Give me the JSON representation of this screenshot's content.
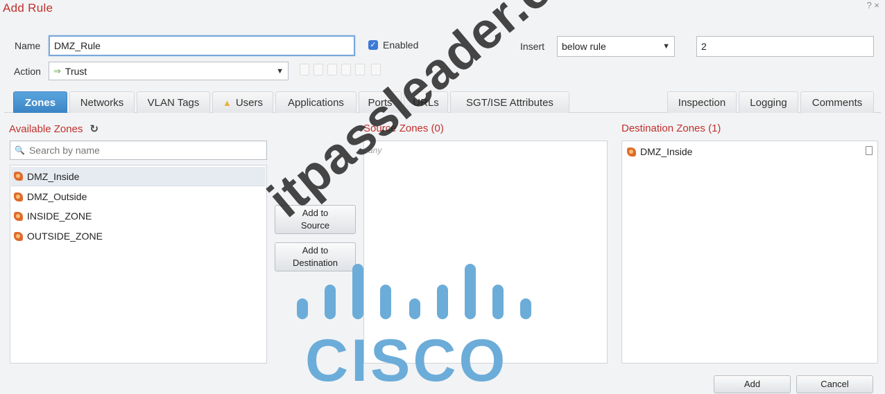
{
  "window": {
    "title": "Add Rule",
    "controls": "? ×"
  },
  "form": {
    "name_label": "Name",
    "name_value": "DMZ_Rule",
    "enabled_label": "Enabled",
    "insert_label": "Insert",
    "insert_value": "below rule",
    "insert_number": "2",
    "action_label": "Action",
    "action_value": "Trust"
  },
  "tabs": [
    {
      "label": "Zones",
      "active": true
    },
    {
      "label": "Networks"
    },
    {
      "label": "VLAN Tags"
    },
    {
      "label": "Users",
      "warning": true
    },
    {
      "label": "Applications"
    },
    {
      "label": "Ports"
    },
    {
      "label": "URLs"
    },
    {
      "label": "SGT/ISE Attributes"
    },
    {
      "label": "Inspection"
    },
    {
      "label": "Logging"
    },
    {
      "label": "Comments"
    }
  ],
  "available_zones": {
    "title": "Available Zones",
    "search_placeholder": "Search by name",
    "items": [
      "DMZ_Inside",
      "DMZ_Outside",
      "INSIDE_ZONE",
      "OUTSIDE_ZONE"
    ]
  },
  "buttons": {
    "add_to_source": [
      "Add to",
      "Source"
    ],
    "add_to_destination": [
      "Add to",
      "Destination"
    ],
    "add": "Add",
    "cancel": "Cancel"
  },
  "source_zones": {
    "title": "Source Zones (0)",
    "empty_text": "any"
  },
  "destination_zones": {
    "title": "Destination Zones (1)",
    "items": [
      "DMZ_Inside"
    ]
  },
  "watermark": {
    "text": "itpassleader.com",
    "brand": "CISCO"
  },
  "colors": {
    "accent_red": "#c0302b",
    "tab_active": "#3a84c5",
    "cisco_blue": "#6cacd9",
    "checkbox": "#3d7ad6"
  },
  "icons": [
    "refresh-icon",
    "search-icon",
    "zone-icon",
    "trash-icon",
    "arrow-right-icon",
    "chevron-down-icon",
    "warning-icon"
  ]
}
